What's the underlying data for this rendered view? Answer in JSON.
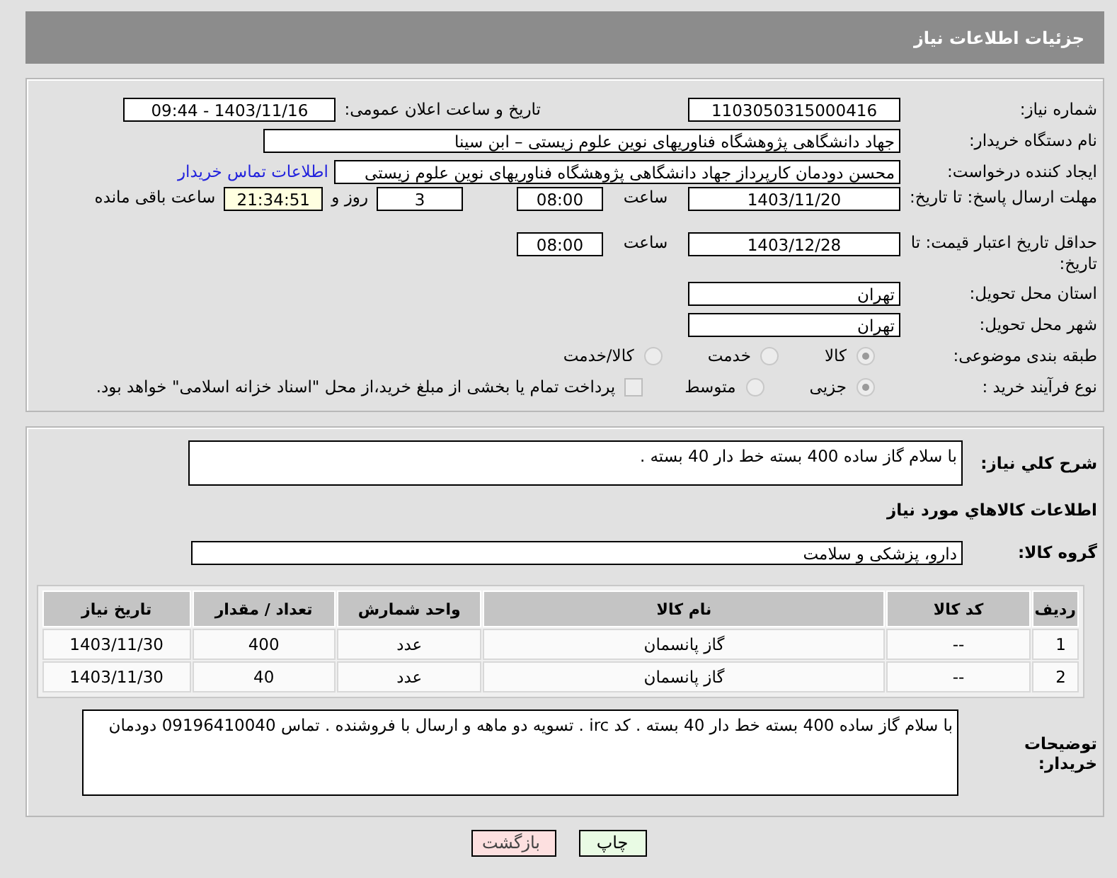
{
  "header": {
    "title": "جزئیات اطلاعات نیاز"
  },
  "details": {
    "need_number": {
      "label": "شماره نیاز:",
      "value": "1103050315000416"
    },
    "announce": {
      "label": "تاریخ و ساعت اعلان عمومی:",
      "value": "1403/11/16 - 09:44"
    },
    "buyer_org": {
      "label": "نام دستگاه خریدار:",
      "value": "جهاد دانشگاهی پژوهشگاه فناوریهای نوین علوم زیستی – ابن سینا"
    },
    "requester": {
      "label": "ایجاد کننده درخواست:",
      "value": "محسن دودمان کارپرداز جهاد دانشگاهی پژوهشگاه فناوریهای نوین علوم زیستی",
      "link": "اطلاعات تماس خریدار"
    },
    "response_deadline": {
      "label": "مهلت ارسال پاسخ: تا تاریخ:",
      "date": "1403/11/20",
      "time_label": "ساعت",
      "time": "08:00",
      "days": "3",
      "days_label": "روز و",
      "remaining": "21:34:51",
      "remaining_label": "ساعت باقی مانده"
    },
    "price_validity": {
      "label": "حداقل تاریخ اعتبار قیمت: تا تاریخ:",
      "date": "1403/12/28",
      "time_label": "ساعت",
      "time": "08:00"
    },
    "province": {
      "label": "استان محل تحویل:",
      "value": "تهران"
    },
    "city": {
      "label": "شهر محل تحویل:",
      "value": "تهران"
    },
    "category": {
      "label": "طبقه بندی موضوعی:",
      "options": [
        {
          "label": "کالا",
          "selected": true
        },
        {
          "label": "خدمت",
          "selected": false
        },
        {
          "label": "کالا/خدمت",
          "selected": false
        }
      ]
    },
    "process": {
      "label": "نوع فرآیند خرید :",
      "options": [
        {
          "label": "جزیی",
          "selected": true
        },
        {
          "label": "متوسط",
          "selected": false
        }
      ],
      "payment": {
        "checked": false,
        "text": "پرداخت تمام یا بخشی از مبلغ خرید،از محل \"اسناد خزانه اسلامی\" خواهد بود."
      }
    }
  },
  "items": {
    "summary_label": "شرح کلي نياز:",
    "summary": "با سلام گاز ساده 400 بسته خط دار 40 بسته .",
    "section_title": "اطلاعات کالاهاي مورد نياز",
    "group_label": "گروه کالا:",
    "group": "دارو، پزشکی و سلامت",
    "table": {
      "columns": [
        "ردیف",
        "کد کالا",
        "نام کالا",
        "واحد شمارش",
        "تعداد / مقدار",
        "تاریخ نیاز"
      ],
      "rows": [
        [
          "1",
          "--",
          "گاز پانسمان",
          "عدد",
          "400",
          "1403/11/30"
        ],
        [
          "2",
          "--",
          "گاز پانسمان",
          "عدد",
          "40",
          "1403/11/30"
        ]
      ]
    },
    "notes_label": "توضیحات خریدار:",
    "notes": "با سلام گاز ساده 400 بسته خط دار 40 بسته . کد irc . تسویه دو ماهه و ارسال با فروشنده . تماس 09196410040 دودمان"
  },
  "buttons": [
    {
      "label": "چاپ",
      "kind": "print"
    },
    {
      "label": "بازگشت",
      "kind": "back"
    }
  ]
}
